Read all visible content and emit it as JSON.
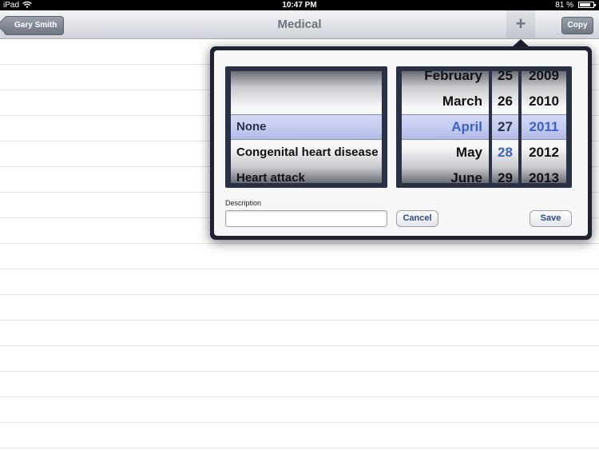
{
  "status_bar": {
    "carrier": "iPad",
    "time": "10:47 PM",
    "battery": "81 %"
  },
  "nav": {
    "back_label": "Gary Smith",
    "title": "Medical",
    "add_label": "+",
    "copy_label": "Copy"
  },
  "condition_picker": {
    "items": [
      "",
      "None",
      "Congenital heart disease",
      "Heart attack"
    ],
    "selected": "None"
  },
  "date_picker": {
    "months": [
      "February",
      "March",
      "April",
      "May",
      "June"
    ],
    "days": [
      "25",
      "26",
      "27",
      "28",
      "29"
    ],
    "years": [
      "2009",
      "2010",
      "2011",
      "2012",
      "2013"
    ],
    "selected": {
      "month": "April",
      "day": "27",
      "year": "2011"
    },
    "today_day": "28"
  },
  "form": {
    "description_label": "Description",
    "description_value": "",
    "cancel_label": "Cancel",
    "save_label": "Save"
  }
}
